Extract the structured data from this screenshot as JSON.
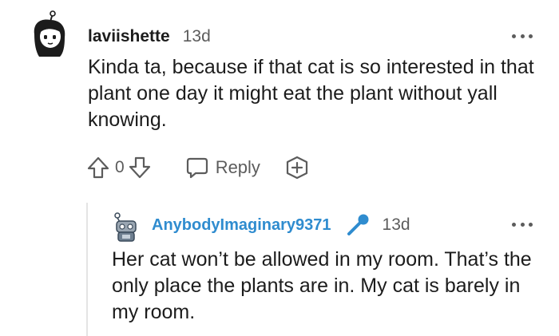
{
  "comment": {
    "username": "laviishette",
    "age": "13d",
    "body": "Kinda ta, because if that cat is so interested in that plant one day it might eat the plant without yall knowing.",
    "score": "0",
    "reply_label": "Reply",
    "icons": [
      "avatar",
      "more-options-icon",
      "upvote-icon",
      "downvote-icon",
      "reply-icon",
      "award-icon"
    ]
  },
  "reply": {
    "username": "AnybodyImaginary9371",
    "age": "13d",
    "body": "Her cat won’t be allowed in my room. That’s the only place the plants are in. My cat is barely in my room.",
    "icons": [
      "avatar",
      "microphone-icon",
      "more-options-icon"
    ]
  },
  "colors": {
    "text": "#1c1c1c",
    "meta": "#5c5c5c",
    "reply_username": "#2f8ccf",
    "thread_line": "#e4e4e4"
  }
}
